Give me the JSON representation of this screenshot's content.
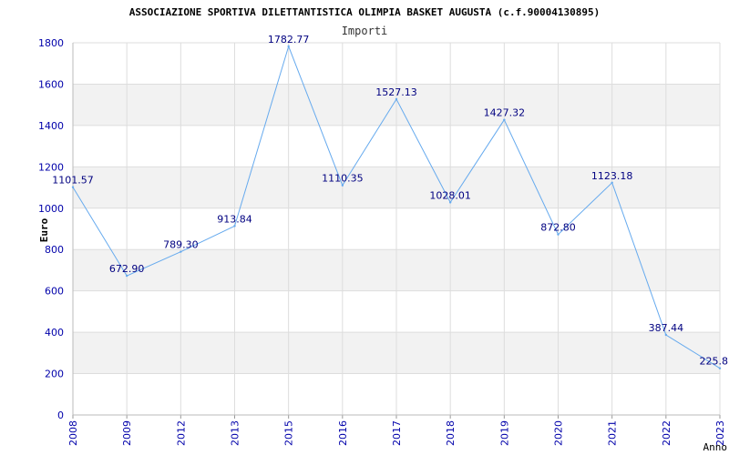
{
  "chart_data": {
    "type": "line",
    "title": "ASSOCIAZIONE SPORTIVA DILETTANTISTICA OLIMPIA BASKET AUGUSTA (c.f.90004130895)",
    "subtitle": "Importi",
    "xlabel": "Anno",
    "ylabel": "Euro",
    "ylim": [
      0,
      1800
    ],
    "yticks": [
      "0",
      "200",
      "400",
      "600",
      "800",
      "1000",
      "1200",
      "1400",
      "1600",
      "1800"
    ],
    "grid": true,
    "legend": "none",
    "categories": [
      "2008",
      "2009",
      "2012",
      "2013",
      "2015",
      "2016",
      "2017",
      "2018",
      "2019",
      "2020",
      "2021",
      "2022",
      "2023"
    ],
    "series": [
      {
        "values": [
          1101.57,
          672.9,
          789.3,
          913.84,
          1782.77,
          1110.35,
          1527.13,
          1028.01,
          1427.32,
          872.8,
          1123.18,
          387.44,
          225.8
        ],
        "labels": [
          "1101.57",
          "672.90",
          "789.30",
          "913.84",
          "1782.77",
          "1110.35",
          "1527.13",
          "1028.01",
          "1427.32",
          "872.80",
          "1123.18",
          "387.44",
          "225.8"
        ]
      }
    ],
    "colors": {
      "line": "#66aaee",
      "axis_text": "#0000aa",
      "title": "#000000",
      "band": "#f2f2f2",
      "grid": "#dddddd",
      "label": "#000080"
    }
  }
}
